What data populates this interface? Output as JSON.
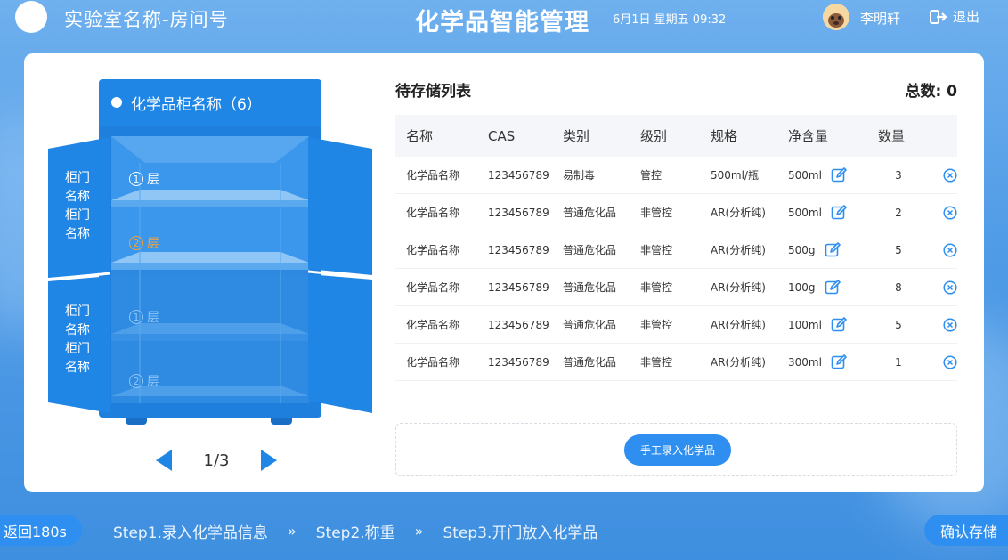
{
  "header": {
    "lab_name": "实验室名称-房间号",
    "app_title": "化学品智能管理",
    "datetime": "6月1日  星期五  09:32",
    "user_name": "李明轩",
    "logout_label": "退出"
  },
  "cabinet": {
    "label": "化学品柜名称（6）",
    "door_text": "柜门\n名称\n柜门\n名称",
    "layers": [
      {
        "num": "1",
        "label": "层",
        "color": "#ffffff"
      },
      {
        "num": "2",
        "label": "层",
        "color": "#f2a33a"
      },
      {
        "num": "1",
        "label": "层",
        "color": "#8ec6f7"
      },
      {
        "num": "2",
        "label": "层",
        "color": "#8ec6f7"
      }
    ],
    "page": "1/3"
  },
  "list": {
    "title": "待存储列表",
    "total_label": "总数: 0",
    "columns": [
      "名称",
      "CAS",
      "类别",
      "级别",
      "规格",
      "净含量",
      "数量"
    ],
    "rows": [
      {
        "name": "化学品名称",
        "cas": "123456789",
        "category": "易制毒",
        "level": "管控",
        "spec": "500ml/瓶",
        "net": "500ml",
        "qty": "3"
      },
      {
        "name": "化学品名称",
        "cas": "123456789",
        "category": "普通危化品",
        "level": "非管控",
        "spec": "AR(分析纯)",
        "net": "500ml",
        "qty": "2"
      },
      {
        "name": "化学品名称",
        "cas": "123456789",
        "category": "普通危化品",
        "level": "非管控",
        "spec": "AR(分析纯)",
        "net": "500g",
        "qty": "5"
      },
      {
        "name": "化学品名称",
        "cas": "123456789",
        "category": "普通危化品",
        "level": "非管控",
        "spec": "AR(分析纯)",
        "net": "100g",
        "qty": "8"
      },
      {
        "name": "化学品名称",
        "cas": "123456789",
        "category": "普通危化品",
        "level": "非管控",
        "spec": "AR(分析纯)",
        "net": "100ml",
        "qty": "5"
      },
      {
        "name": "化学品名称",
        "cas": "123456789",
        "category": "普通危化品",
        "level": "非管控",
        "spec": "AR(分析纯)",
        "net": "300ml",
        "qty": "1"
      }
    ],
    "manual_button": "手工录入化学品"
  },
  "footer": {
    "back_label": "返回180s",
    "steps": [
      "Step1.录入化学品信息",
      "Step2.称重",
      "Step3.开门放入化学品"
    ],
    "separator": "»",
    "confirm_label": "确认存储"
  },
  "colors": {
    "primary": "#2f8ff0",
    "cabinet": "#1f7fdc",
    "highlight": "#f2a33a"
  },
  "icons": {
    "logout": "logout-icon",
    "edit": "edit-icon",
    "delete": "close-circle-icon",
    "prev": "arrow-left-icon",
    "next": "arrow-right-icon"
  }
}
